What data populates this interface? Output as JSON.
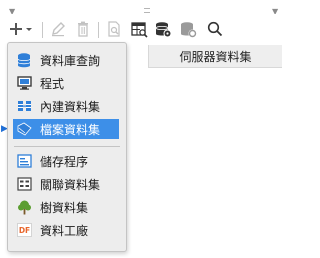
{
  "toolbar": {
    "buttons": [
      {
        "name": "add-button",
        "icon": "plus-icon",
        "has_dropdown": true
      },
      {
        "name": "edit-button",
        "icon": "pencil-icon",
        "enabled": false
      },
      {
        "name": "delete-button",
        "icon": "trash-icon",
        "enabled": false
      },
      {
        "name": "preview-button",
        "icon": "document-search-icon",
        "enabled": false
      },
      {
        "name": "query-button",
        "icon": "table-search-icon"
      },
      {
        "name": "database-button",
        "icon": "database-gear-icon"
      },
      {
        "name": "database-sync-button",
        "icon": "database-refresh-icon",
        "enabled": false
      },
      {
        "name": "search-button",
        "icon": "search-icon"
      }
    ]
  },
  "table": {
    "column_header": "伺服器資料集"
  },
  "menu": {
    "items": [
      {
        "label": "資料庫查詢",
        "icon": "database-icon",
        "selected": false
      },
      {
        "label": "程式",
        "icon": "monitor-icon",
        "selected": false
      },
      {
        "label": "內建資料集",
        "icon": "builtin-table-icon",
        "selected": false
      },
      {
        "label": "檔案資料集",
        "icon": "file-tag-icon",
        "selected": true
      },
      {
        "label": "儲存程序",
        "icon": "stored-procedure-icon",
        "selected": false
      },
      {
        "label": "關聯資料集",
        "icon": "relation-icon",
        "selected": false
      },
      {
        "label": "樹資料集",
        "icon": "tree-icon",
        "selected": false
      },
      {
        "label": "資料工廠",
        "icon": "df-icon",
        "selected": false
      }
    ]
  },
  "colors": {
    "selection": "#3d8fe8",
    "menu_bg": "#ededed",
    "icon_blue": "#2f7fd8",
    "icon_gray": "#6a6a6a",
    "icon_disabled": "#c2c2c2",
    "tree_green": "#5c9e31",
    "df_orange": "#e8662c"
  }
}
